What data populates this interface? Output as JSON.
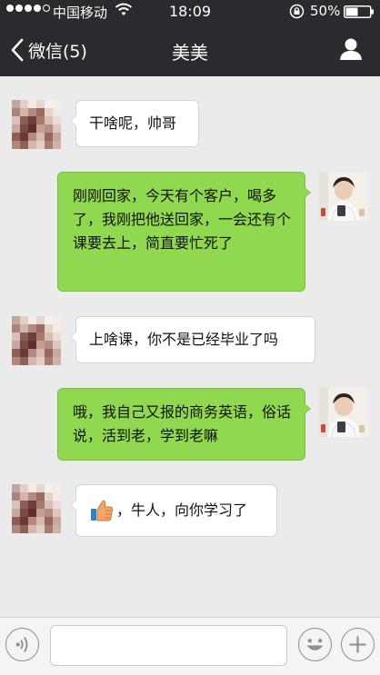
{
  "status_bar": {
    "carrier": "中国移动",
    "time": "18:09",
    "battery_percent": "50%",
    "signal_bars_filled": 4,
    "signal_bars_total": 5
  },
  "nav": {
    "back_label": "微信(5)",
    "title": "美美",
    "profile_icon": "person-icon"
  },
  "messages": [
    {
      "sender": "contact",
      "text": "干啥呢，帅哥"
    },
    {
      "sender": "me",
      "text": "刚刚回家，今天有个客户，喝多了，我刚把他送回家，一会还有个课要去上，简直要忙死了"
    },
    {
      "sender": "contact",
      "text": "上啥课，你不是已经毕业了吗"
    },
    {
      "sender": "me",
      "text": "哦，我自己又报的商务英语，俗话说，活到老，学到老嘛"
    },
    {
      "sender": "contact",
      "emoji": "thumbs-up-icon",
      "text": "，牛人，向你学习了"
    }
  ],
  "input_bar": {
    "placeholder": "",
    "voice_icon": "voice-icon",
    "emoji_icon": "emoji-icon",
    "plus_icon": "plus-icon"
  },
  "colors": {
    "nav_bg": "#2b2b2f",
    "chat_bg": "#ebebeb",
    "outgoing_bubble": "#8fd84f",
    "incoming_bubble": "#ffffff"
  }
}
